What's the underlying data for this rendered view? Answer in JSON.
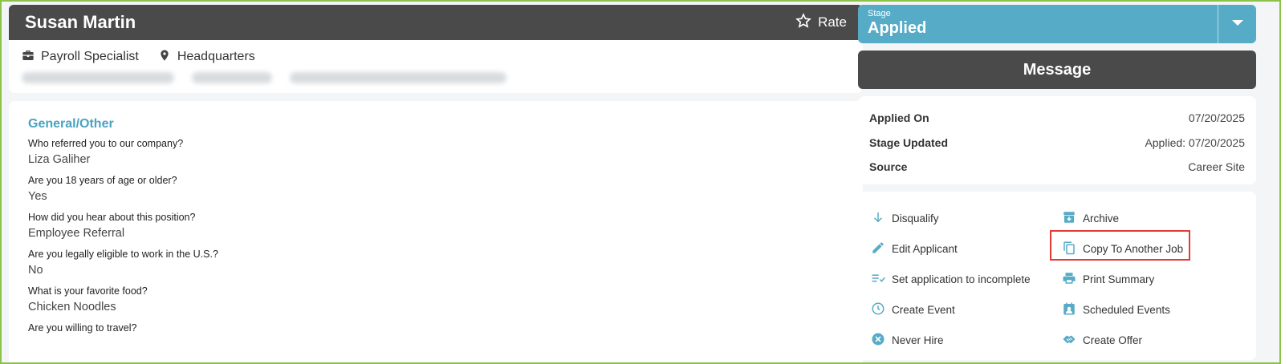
{
  "candidate": {
    "name": "Susan Martin",
    "rate_label": "Rate",
    "job_title": "Payroll Specialist",
    "location": "Headquarters"
  },
  "questions_section": {
    "title": "General/Other",
    "items": [
      {
        "q": "Who referred you to our company?",
        "a": "Liza Galiher"
      },
      {
        "q": "Are you 18 years of age or older?",
        "a": "Yes"
      },
      {
        "q": "How did you hear about this position?",
        "a": "Employee Referral"
      },
      {
        "q": "Are you legally eligible to work in the U.S.?",
        "a": "No"
      },
      {
        "q": "What is your favorite food?",
        "a": "Chicken Noodles"
      },
      {
        "q": "Are you willing to travel?",
        "a": ""
      }
    ]
  },
  "stage": {
    "label": "Stage",
    "value": "Applied"
  },
  "message_label": "Message",
  "meta": [
    {
      "k": "Applied On",
      "v": "07/20/2025"
    },
    {
      "k": "Stage Updated",
      "v": "Applied: 07/20/2025"
    },
    {
      "k": "Source",
      "v": "Career Site"
    }
  ],
  "actions": [
    {
      "label": "Disqualify",
      "icon": "arrow-down-icon"
    },
    {
      "label": "Archive",
      "icon": "archive-icon"
    },
    {
      "label": "Edit Applicant",
      "icon": "pencil-icon"
    },
    {
      "label": "Copy To Another Job",
      "icon": "copy-icon"
    },
    {
      "label": "Set application to incomplete",
      "icon": "list-check-icon"
    },
    {
      "label": "Print Summary",
      "icon": "printer-icon"
    },
    {
      "label": "Create Event",
      "icon": "clock-icon"
    },
    {
      "label": "Scheduled Events",
      "icon": "calendar-person-icon"
    },
    {
      "label": "Never Hire",
      "icon": "x-circle-icon"
    },
    {
      "label": "Create Offer",
      "icon": "handshake-icon"
    }
  ],
  "colors": {
    "accent": "#56abc6",
    "dark": "#4a4a4a",
    "highlight": "#e53935",
    "frame": "#8bc34a"
  }
}
